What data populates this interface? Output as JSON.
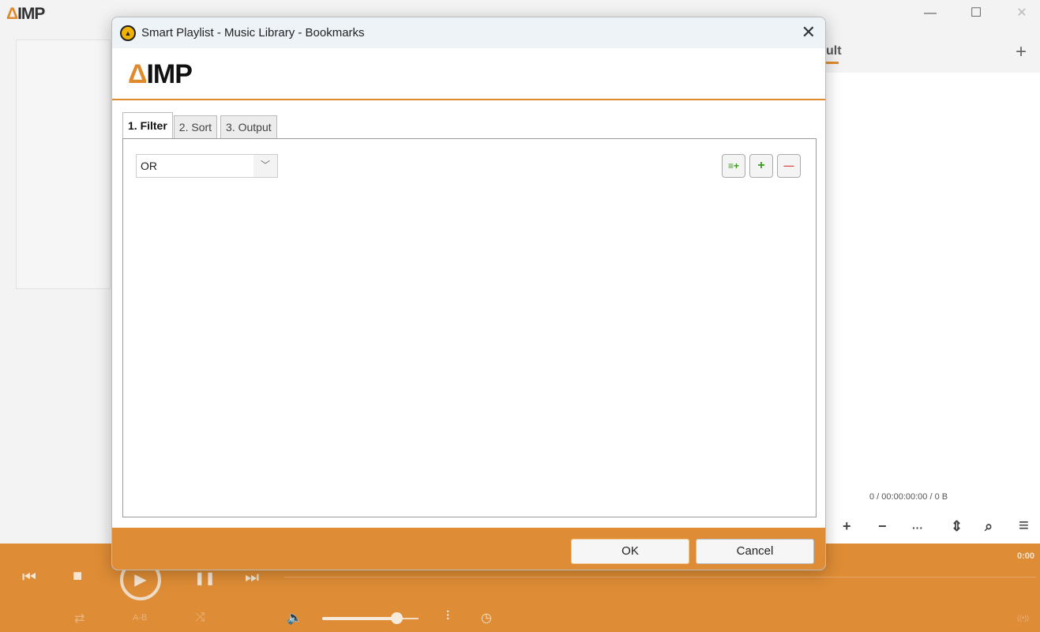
{
  "app": {
    "logo_mark": "Δ",
    "logo_text": "IMP",
    "tab_partial": "ult",
    "add_tab": "+",
    "stats": "0 / 00:00:00:00 / 0 B",
    "time": "0:00",
    "window_controls": {
      "minimize": "—",
      "maximize": "☐",
      "close": "✕"
    },
    "playlist_tools": [
      "+",
      "−",
      "···",
      "⇕",
      "⌕",
      "≡"
    ],
    "player": {
      "prev": "⏮",
      "stop": "■",
      "play": "▶",
      "pause": "❚❚",
      "next": "⏭",
      "repeat": "⇄",
      "ab": "A-B",
      "shuffle": "⤨",
      "volume_icon": "🔈",
      "eq": "⫶",
      "timer": "◷",
      "broadcast": "((•))",
      "volume_percent": 78
    },
    "accent": "#de8c35"
  },
  "dialog": {
    "title": "Smart Playlist - Music Library - Bookmarks",
    "close": "✕",
    "logo_mark": "Δ",
    "logo_text": "IMP",
    "tabs": [
      {
        "label": "1. Filter",
        "active": true
      },
      {
        "label": "2. Sort"
      },
      {
        "label": "3. Output"
      }
    ],
    "filter": {
      "operator": "OR",
      "add_condition": "≡+",
      "add_group": "+",
      "remove": "—"
    },
    "ok": "OK",
    "cancel": "Cancel"
  }
}
